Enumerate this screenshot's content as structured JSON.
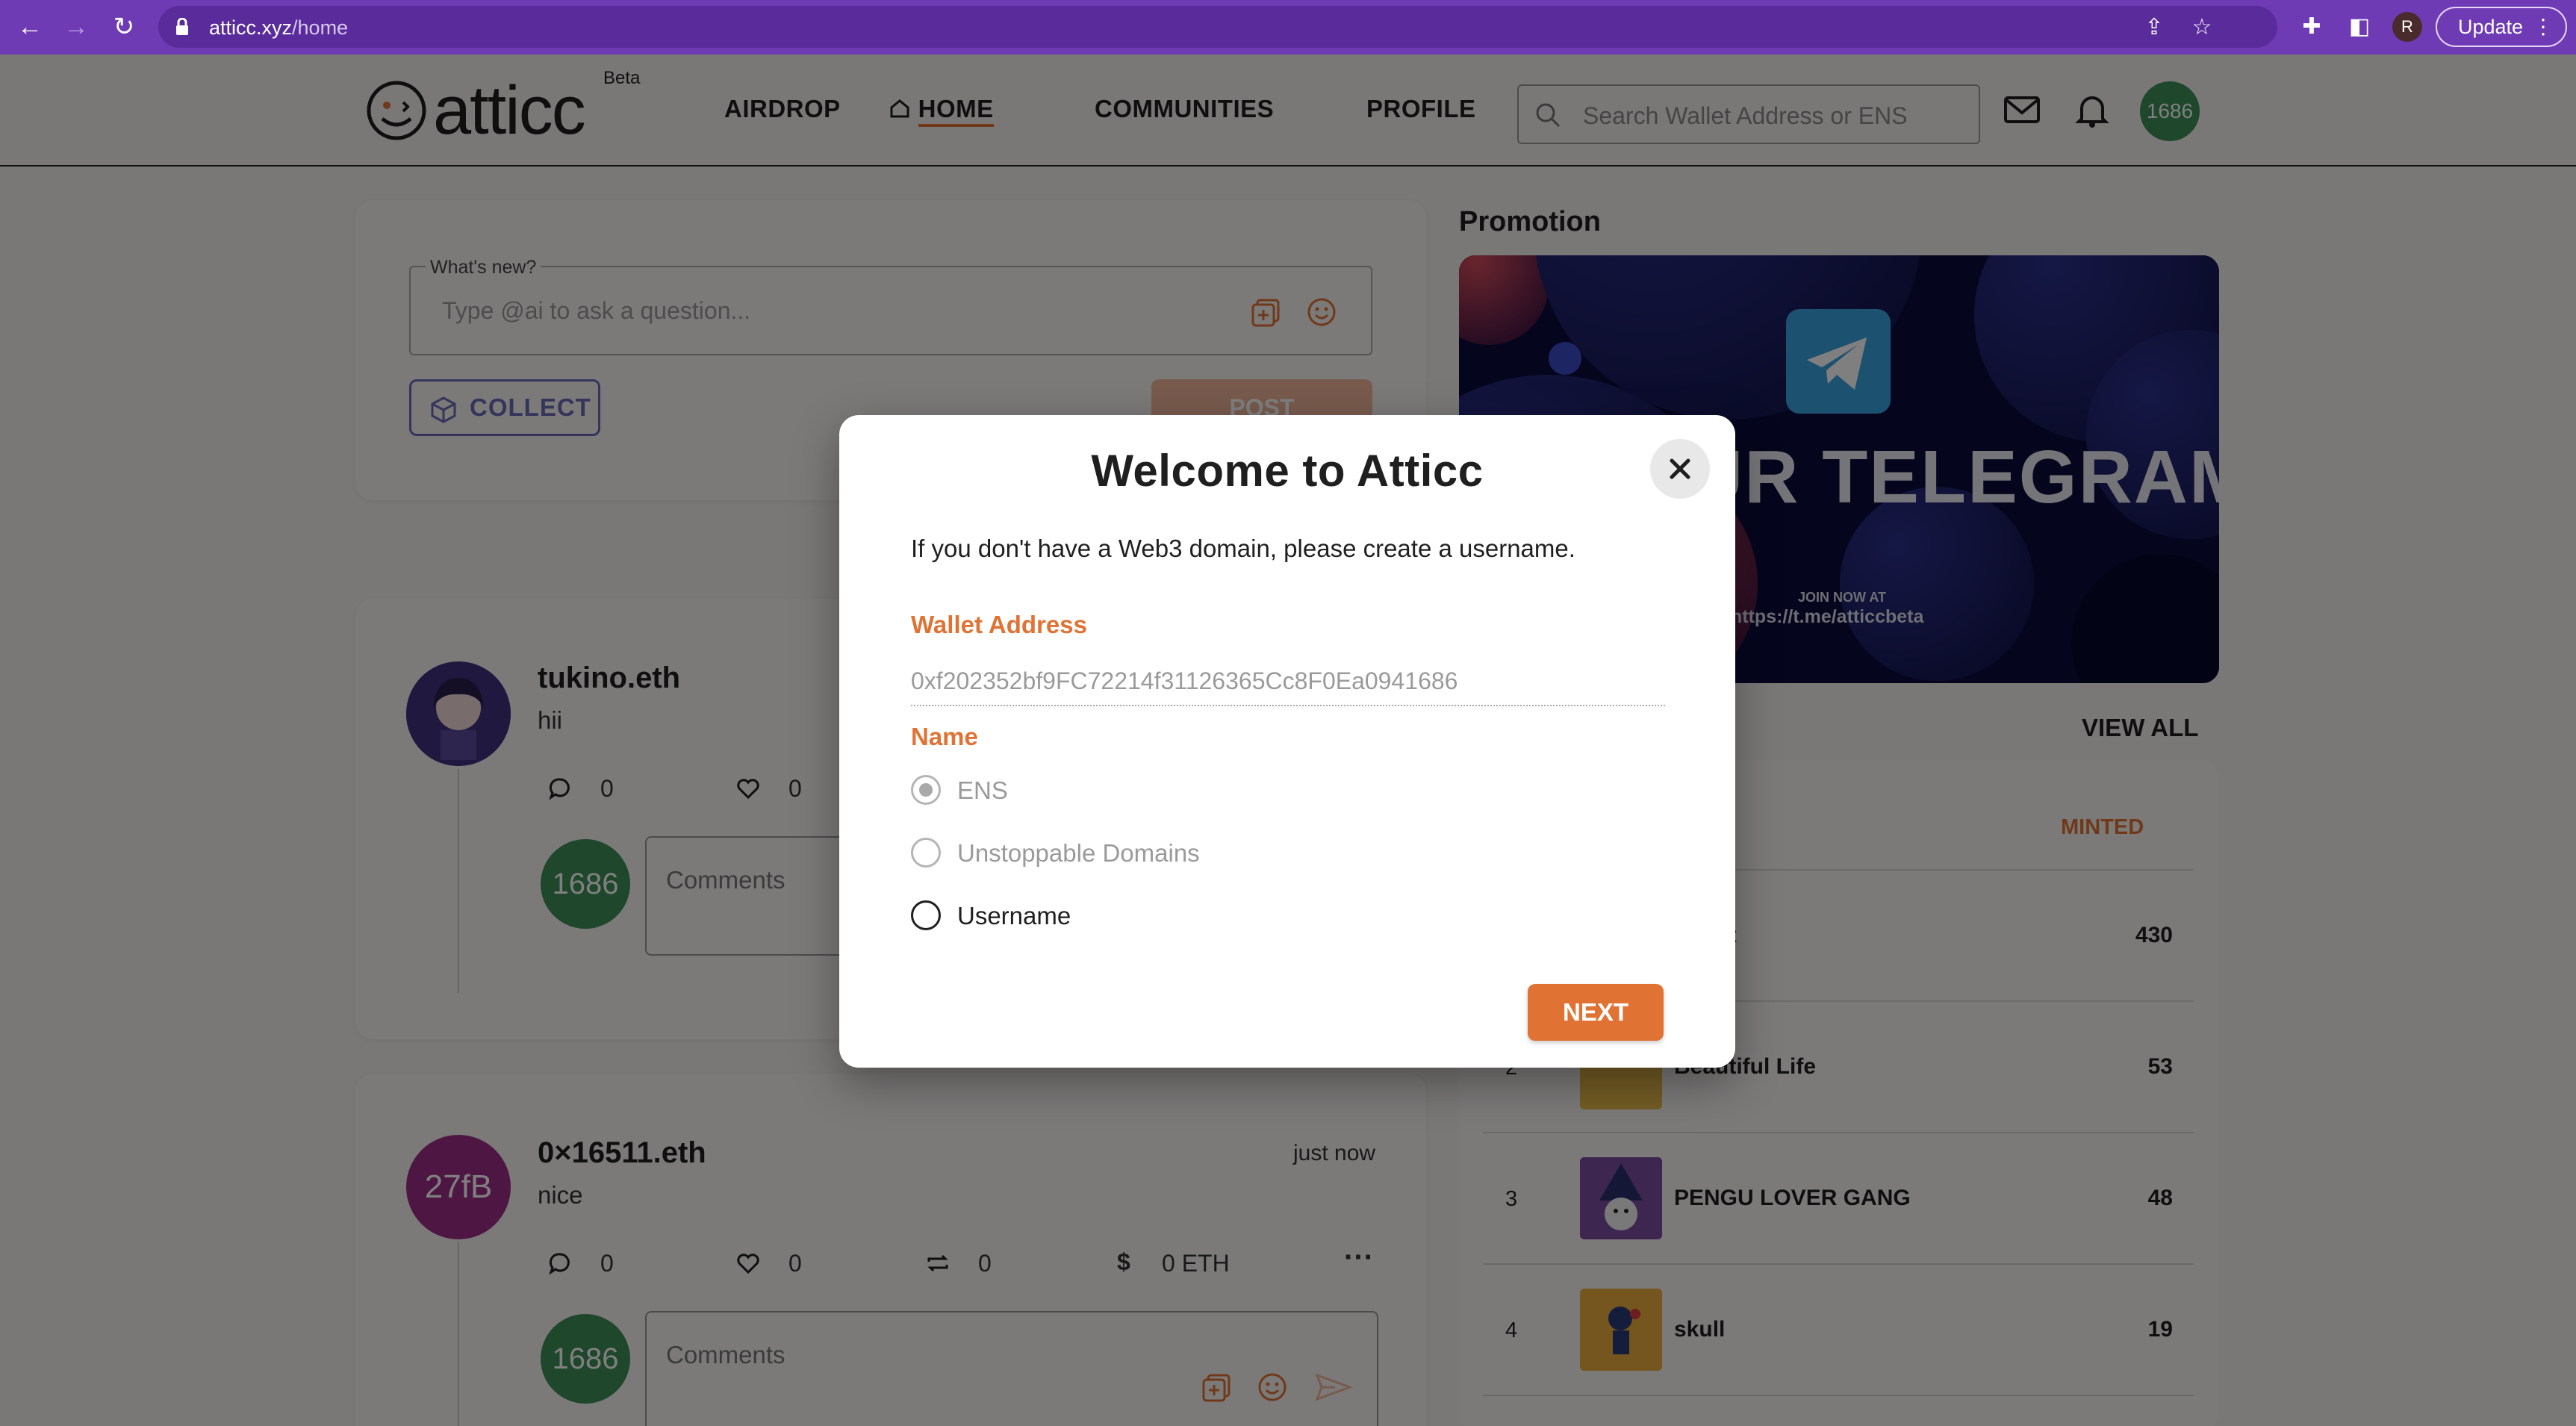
{
  "browser": {
    "url_host": "atticc.xyz",
    "url_path": "/home",
    "profile_initial": "R",
    "update_label": "Update"
  },
  "header": {
    "logo_text": "atticc",
    "beta_label": "Beta",
    "nav": {
      "airdrop": "AIRDROP",
      "home": "HOME",
      "communities": "COMMUNITIES",
      "profile": "PROFILE"
    },
    "search_placeholder": "Search Wallet Address or ENS",
    "user_avatar": "1686"
  },
  "composer": {
    "label": "What's new?",
    "placeholder": "Type @ai to ask a question...",
    "collect_label": "COLLECT",
    "post_label": "POST"
  },
  "posts": [
    {
      "author": "tukino.eth",
      "text": "hii",
      "replies": "0",
      "likes": "0",
      "commenter_avatar": "1686",
      "comment_placeholder": "Comments"
    },
    {
      "author": "0×16511.eth",
      "avatar_text": "27fB",
      "time": "just now",
      "text": "nice",
      "replies": "0",
      "likes": "0",
      "reposts": "0",
      "tips": "0 ETH",
      "commenter_avatar": "1686",
      "comment_placeholder": "Comments"
    }
  ],
  "promotion": {
    "title": "Promotion",
    "banner_headline": "UR TELEGRAM",
    "banner_join": "JOIN NOW AT",
    "banner_link": "https://t.me/atticcbeta"
  },
  "collections": {
    "view_all": "VIEW ALL",
    "minted_header": "MINTED",
    "rows": [
      {
        "rank": "",
        "name": "sight",
        "minted": "430"
      },
      {
        "rank": "2",
        "name": "Beautiful Life",
        "minted": "53"
      },
      {
        "rank": "3",
        "name": "PENGU LOVER GANG",
        "minted": "48"
      },
      {
        "rank": "4",
        "name": "skull",
        "minted": "19"
      }
    ]
  },
  "modal": {
    "title": "Welcome to Atticc",
    "description": "If you don't have a Web3 domain, please create a username.",
    "wallet_label": "Wallet Address",
    "wallet_value": "0xf202352bf9FC72214f31126365Cc8F0Ea0941686",
    "name_label": "Name",
    "options": [
      "ENS",
      "Unstoppable Domains",
      "Username"
    ],
    "selected_option": "ENS",
    "next_label": "NEXT"
  },
  "colors": {
    "accent": "#e07334",
    "browser_frame": "#6e3bb5",
    "avatar_green": "#3e8e57",
    "avatar_purple": "#9c2f86"
  }
}
